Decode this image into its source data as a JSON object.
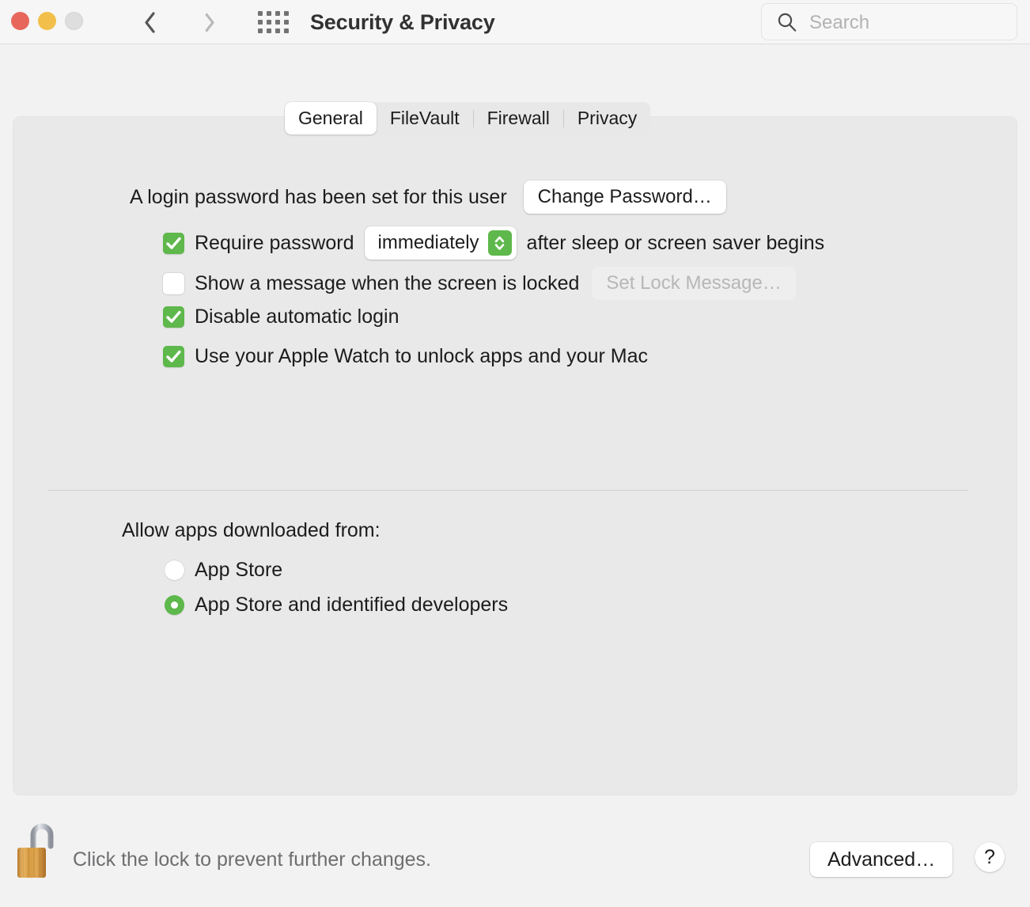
{
  "window": {
    "title": "Security & Privacy",
    "traffic_lights": [
      {
        "name": "close",
        "color": "#e8675d"
      },
      {
        "name": "minimize",
        "color": "#f2bf4a"
      },
      {
        "name": "zoom",
        "color": "#dedede"
      }
    ],
    "nav": {
      "back": "back-arrow",
      "forward": "forward-arrow"
    },
    "grid_icon": "show-all-icon"
  },
  "search": {
    "placeholder": "Search",
    "icon": "search-icon",
    "value": ""
  },
  "tabs": [
    {
      "label": "General",
      "selected": true
    },
    {
      "label": "FileVault",
      "selected": false
    },
    {
      "label": "Firewall",
      "selected": false
    },
    {
      "label": "Privacy",
      "selected": false
    }
  ],
  "general": {
    "password_status": "A login password has been set for this user",
    "change_password_button": "Change Password…",
    "require_password": {
      "label": "Require password",
      "checked": true,
      "popup_value": "immediately",
      "suffix": "after sleep or screen saver begins"
    },
    "lock_message": {
      "label": "Show a message when the screen is locked",
      "checked": false,
      "button": "Set Lock Message…",
      "button_disabled": true
    },
    "disable_auto_login": {
      "label": "Disable automatic login",
      "checked": true
    },
    "apple_watch": {
      "label": "Use your Apple Watch to unlock apps and your Mac",
      "checked": true
    },
    "allow_apps": {
      "title": "Allow apps downloaded from:",
      "options": [
        {
          "label": "App Store",
          "selected": false
        },
        {
          "label": "App Store and identified developers",
          "selected": true
        }
      ]
    }
  },
  "footer": {
    "lock_icon": "unlocked-padlock-icon",
    "lock_text": "Click the lock to prevent further changes.",
    "advanced_button": "Advanced…",
    "help_button": "?"
  },
  "colors": {
    "accent_green": "#5eb84b",
    "window_bg": "#f2f2f2",
    "panel_bg": "#e9e9e9",
    "titlebar_bg": "#f6f6f6"
  }
}
